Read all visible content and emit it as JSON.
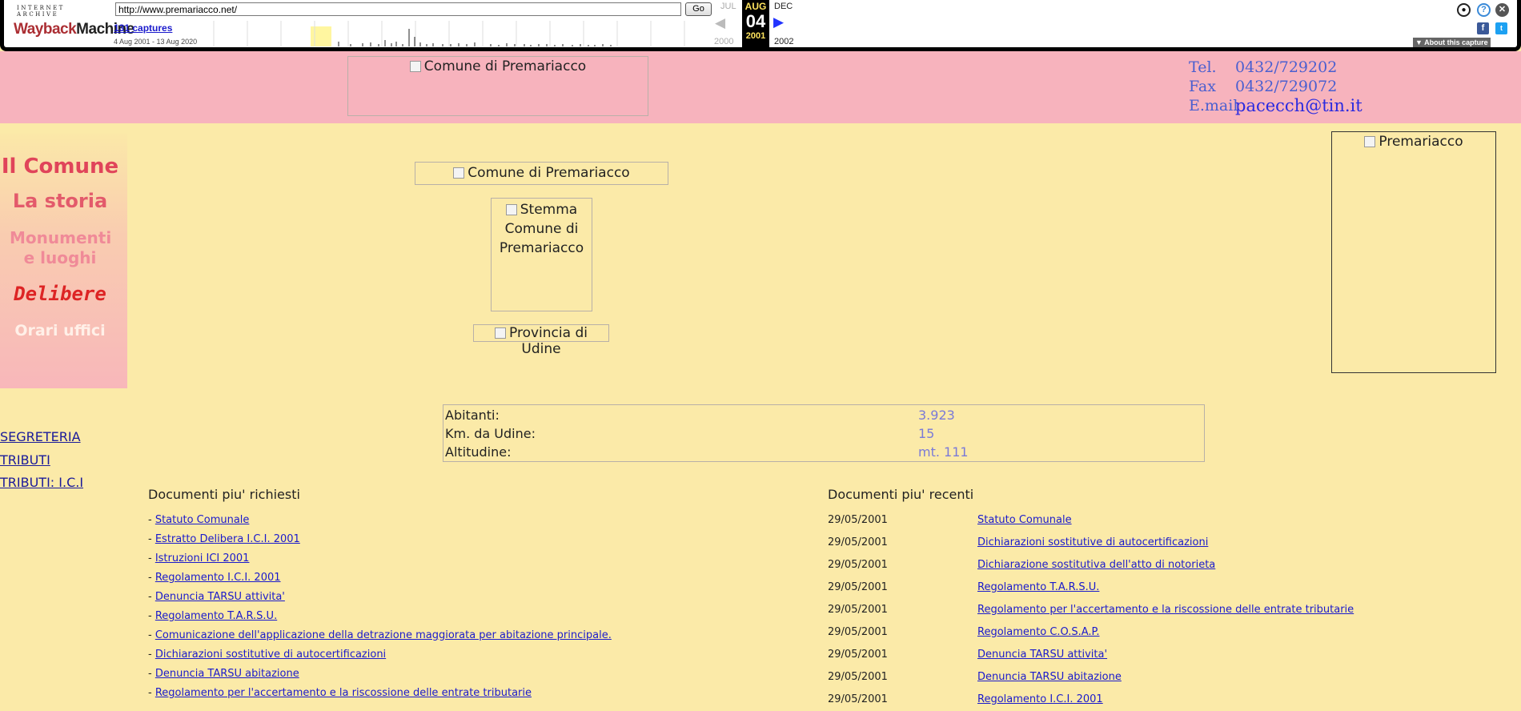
{
  "wayback": {
    "logo_top": "INTERNET ARCHIVE",
    "logo_main_1": "Wayback",
    "logo_main_2": "Machine",
    "url": "http://www.premariacco.net/",
    "go_label": "Go",
    "captures": "131 captures",
    "range": "4 Aug 2001 - 13 Aug 2020",
    "prev_month": "JUL",
    "cur_month": "AUG",
    "next_month": "DEC",
    "cur_day": "04",
    "prev_year": "2000",
    "cur_year": "2001",
    "next_year": "2002",
    "about": "About this capture"
  },
  "header": {
    "banner_alt": "Comune di Premariacco",
    "contact": [
      {
        "label": "Tel.",
        "value": "0432/729202"
      },
      {
        "label": "Fax",
        "value": "0432/729072"
      },
      {
        "label": "E.mail",
        "value": "pacecch@tin.it"
      }
    ]
  },
  "menu": {
    "items": [
      "Il Comune",
      "La storia",
      "Monumenti e luoghi",
      "Delibere",
      "Orari uffici"
    ],
    "colors": {
      "il_comune": "#e0445a",
      "la_storia": "#e35a6b",
      "monumenti": "#f08a98",
      "delibere": "#dd2424",
      "orari": "#fff0e8"
    }
  },
  "center": {
    "title_alt": "Comune di Premariacco",
    "stemma_alt": "Stemma Comune di Premariacco",
    "provincia_alt": "Provincia di Udine",
    "photo_alt": "Premariacco"
  },
  "left_links": [
    "SEGRETERIA",
    "TRIBUTI",
    "TRIBUTI: I.C.I"
  ],
  "info": [
    {
      "label": "Abitanti:",
      "value": "3.923"
    },
    {
      "label": "Km. da Udine:",
      "value": "15"
    },
    {
      "label": "Altitudine:",
      "value": "mt. 111"
    }
  ],
  "popular": {
    "title": "Documenti piu' richiesti",
    "items": [
      "Statuto Comunale",
      "Estratto Delibera I.C.I. 2001",
      "Istruzioni ICI 2001",
      "Regolamento I.C.I. 2001",
      "Denuncia TARSU attivita'",
      "Regolamento T.A.R.S.U.",
      "Comunicazione dell'applicazione della detrazione maggiorata per abitazione principale.",
      "Dichiarazioni sostitutive di autocertificazioni",
      "Denuncia TARSU abitazione",
      "Regolamento per l'accertamento e la riscossione delle entrate tributarie"
    ]
  },
  "recent": {
    "title": "Documenti piu' recenti",
    "items": [
      {
        "date": "29/05/2001",
        "title": "Statuto Comunale"
      },
      {
        "date": "29/05/2001",
        "title": "Dichiarazioni sostitutive di autocertificazioni"
      },
      {
        "date": "29/05/2001",
        "title": "Dichiarazione sostitutiva dell'atto di notorieta"
      },
      {
        "date": "29/05/2001",
        "title": "Regolamento T.A.R.S.U."
      },
      {
        "date": "29/05/2001",
        "title": "Regolamento per l'accertamento e la riscossione delle entrate tributarie"
      },
      {
        "date": "29/05/2001",
        "title": "Regolamento C.O.S.A.P."
      },
      {
        "date": "29/05/2001",
        "title": "Denuncia TARSU attivita'"
      },
      {
        "date": "29/05/2001",
        "title": "Denuncia TARSU abitazione"
      },
      {
        "date": "29/05/2001",
        "title": "Regolamento I.C.I. 2001"
      }
    ]
  }
}
